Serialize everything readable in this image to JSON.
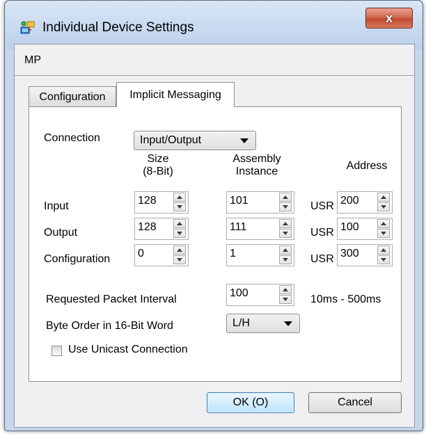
{
  "window": {
    "title": "Individual Device Settings",
    "close_symbol": "x",
    "icon": "device-settings-icon"
  },
  "device_name": "MP",
  "tabs": [
    {
      "label": "Configuration",
      "active": false
    },
    {
      "label": "Implicit Messaging",
      "active": true
    }
  ],
  "connection": {
    "label": "Connection",
    "value": "Input/Output"
  },
  "columns": {
    "size_line1": "Size",
    "size_line2": "(8-Bit)",
    "instance_line1": "Assembly",
    "instance_line2": "Instance",
    "address": "Address"
  },
  "rows": [
    {
      "label": "Input",
      "size": "128",
      "instance": "101",
      "prefix": "USR",
      "address": "200"
    },
    {
      "label": "Output",
      "size": "128",
      "instance": "111",
      "prefix": "USR",
      "address": "100"
    },
    {
      "label": "Configuration",
      "size": "0",
      "instance": "1",
      "prefix": "USR",
      "address": "300"
    }
  ],
  "rpi": {
    "label": "Requested Packet Interval",
    "value": "100",
    "range": "10ms - 500ms"
  },
  "byte_order": {
    "label": "Byte Order in 16-Bit Word",
    "value": "L/H"
  },
  "unicast": {
    "label": "Use Unicast Connection",
    "checked": false
  },
  "buttons": {
    "ok": "OK (O)",
    "cancel": "Cancel"
  }
}
